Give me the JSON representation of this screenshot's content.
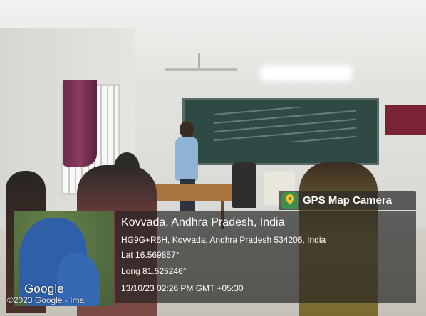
{
  "overlay": {
    "app_badge": {
      "icon": "map-pin-icon",
      "title": "GPS Map Camera"
    },
    "location": "Kovvada, Andhra Pradesh, India",
    "address": "HG9G+R6H, Kovvada, Andhra Pradesh 534206, India",
    "latitude": "Lat 16.569857°",
    "longitude": "Long 81.525246°",
    "datetime": "13/10/23 02:26 PM GMT +05:30"
  },
  "map_thumbnail": {
    "logo": "Google",
    "credit": "©2023 Google - Ima"
  },
  "colors": {
    "overlay_bg": "#232323",
    "badge_green": "#3f8f4a",
    "pin_yellow": "#f2c230"
  }
}
